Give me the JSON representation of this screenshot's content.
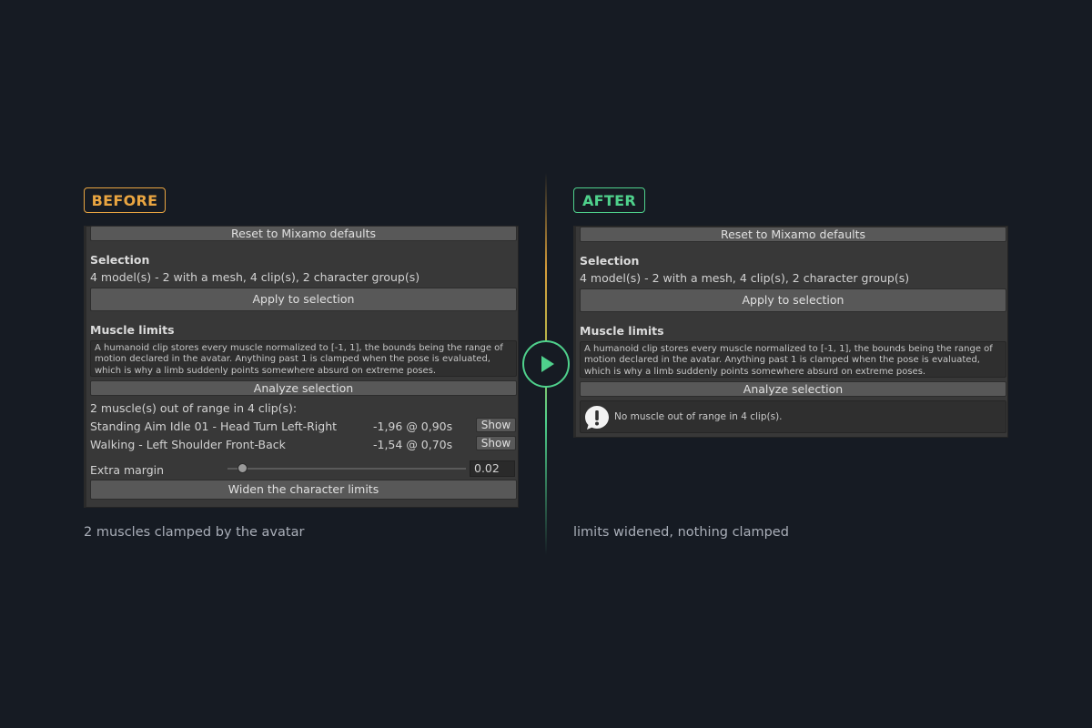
{
  "colors": {
    "before": "#e9a541",
    "after": "#4fd18c",
    "background": "#161b23"
  },
  "before": {
    "badge": "BEFORE",
    "reset_button": "Reset to Mixamo defaults",
    "selection_title": "Selection",
    "selection_summary": "4 model(s) - 2 with a mesh, 4 clip(s), 2 character group(s)",
    "apply_button": "Apply to selection",
    "muscle_title": "Muscle limits",
    "help_text": "A humanoid clip stores every muscle normalized to [-1, 1], the bounds being the range of motion declared in the avatar. Anything past 1 is clamped when the pose is evaluated, which is why a limb suddenly points somewhere absurd on extreme poses.",
    "analyze_button": "Analyze selection",
    "result_summary": "2 muscle(s) out of range in 4 clip(s):",
    "rows": [
      {
        "name": "Standing Aim Idle 01 - Head Turn Left-Right",
        "value": "-1,96 @ 0,90s",
        "button": "Show"
      },
      {
        "name": "Walking - Left Shoulder Front-Back",
        "value": "-1,54 @ 0,70s",
        "button": "Show"
      }
    ],
    "margin_label": "Extra margin",
    "margin_value": "0.02",
    "margin_slider_fraction": 0.06,
    "widen_button": "Widen the character limits",
    "caption": "2 muscles clamped by the avatar"
  },
  "after": {
    "badge": "AFTER",
    "reset_button": "Reset to Mixamo defaults",
    "selection_title": "Selection",
    "selection_summary": "4 model(s) - 2 with a mesh, 4 clip(s), 2 character group(s)",
    "apply_button": "Apply to selection",
    "muscle_title": "Muscle limits",
    "help_text": "A humanoid clip stores every muscle normalized to [-1, 1], the bounds being the range of motion declared in the avatar. Anything past 1 is clamped when the pose is evaluated, which is why a limb suddenly points somewhere absurd on extreme poses.",
    "analyze_button": "Analyze selection",
    "info_icon": "info-icon",
    "info_message": "No muscle out of range in 4 clip(s).",
    "caption": "limits widened, nothing clamped"
  },
  "transition_icon": "play-icon"
}
